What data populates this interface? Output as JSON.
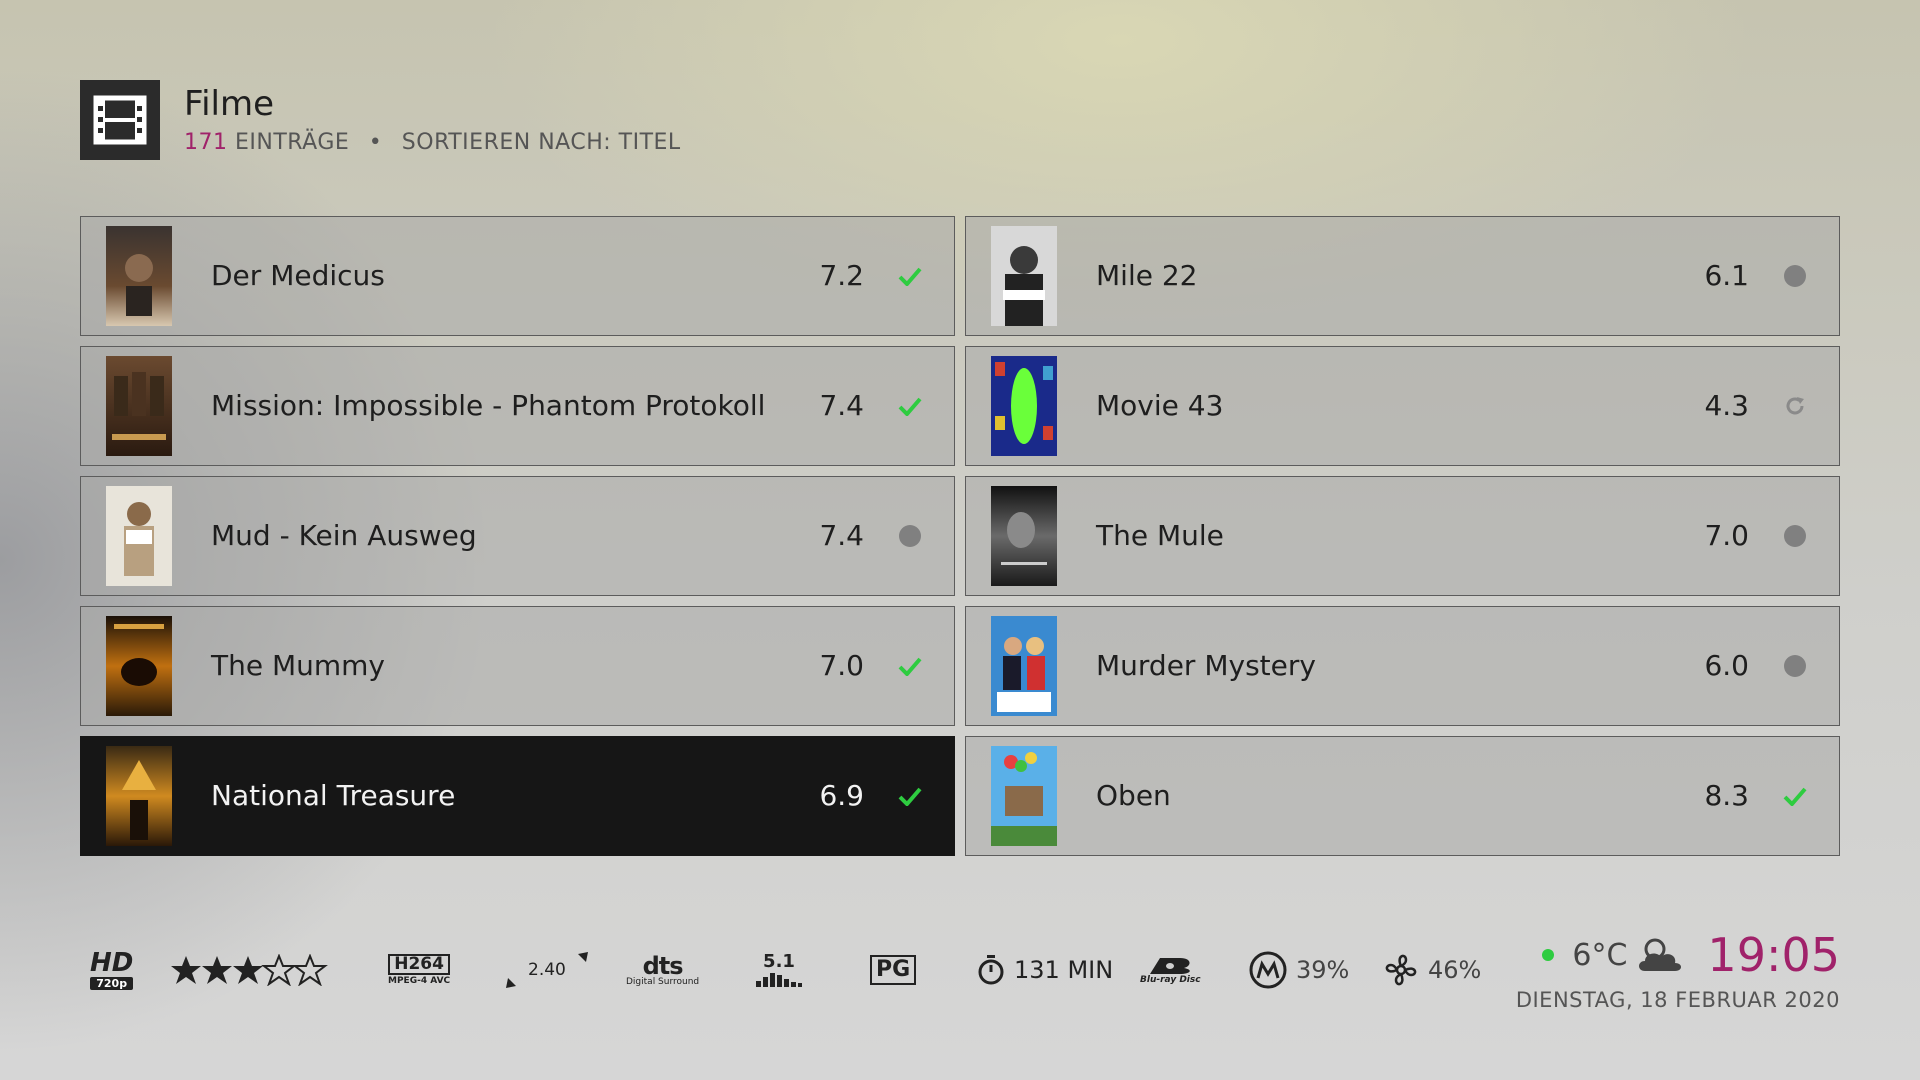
{
  "header": {
    "icon": "film-icon",
    "title": "Filme",
    "count": "171",
    "entries_label": "EINTRÄGE",
    "separator": "•",
    "sort_label": "SORTIEREN NACH: TITEL"
  },
  "left_column": [
    {
      "title": "Der Medicus",
      "rating": "7.2",
      "status": "watched"
    },
    {
      "title": "Mission: Impossible - Phantom Protokoll",
      "rating": "7.4",
      "status": "watched"
    },
    {
      "title": "Mud - Kein Ausweg",
      "rating": "7.4",
      "status": "unwatched"
    },
    {
      "title": "The Mummy",
      "rating": "7.0",
      "status": "watched"
    },
    {
      "title": "National Treasure",
      "rating": "6.9",
      "status": "watched",
      "selected": true
    }
  ],
  "right_column": [
    {
      "title": "Mile 22",
      "rating": "6.1",
      "status": "unwatched"
    },
    {
      "title": "Movie 43",
      "rating": "4.3",
      "status": "in-progress"
    },
    {
      "title": "The Mule",
      "rating": "7.0",
      "status": "unwatched"
    },
    {
      "title": "Murder Mystery",
      "rating": "6.0",
      "status": "unwatched"
    },
    {
      "title": "Oben",
      "rating": "8.3",
      "status": "watched"
    }
  ],
  "footer": {
    "resolution_top": "HD",
    "resolution_bottom": "720p",
    "stars_filled": 3,
    "stars_total": 5,
    "codec_top": "H264",
    "codec_bottom": "MPEG-4 AVC",
    "aspect_ratio": "2.40",
    "audio_top": "dts",
    "audio_bottom": "Digital Surround",
    "channels": "5.1",
    "mpaa": "PG",
    "runtime": "131 MIN",
    "source": "Blu-ray Disc",
    "cpu": "39%",
    "memory": "46%",
    "temperature": "6°C",
    "time": "19:05",
    "date": "DIENSTAG, 18 FEBRUAR 2020"
  },
  "colors": {
    "accent": "#a0226a",
    "check": "#2ecc40",
    "unwatched_dot": "#808080",
    "selected_bg": "#161616",
    "online_dot": "#2ecc40"
  }
}
